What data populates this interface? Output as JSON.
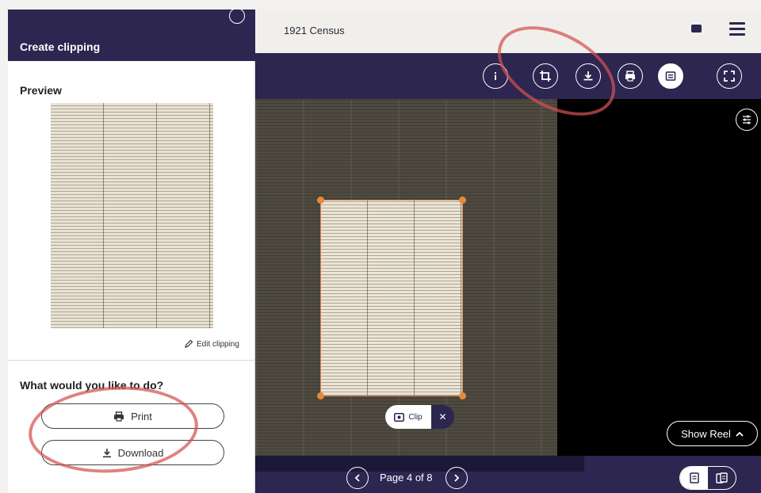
{
  "app": {
    "title": "1921 Census"
  },
  "toolbar": {
    "buttons": [
      {
        "name": "info",
        "icon": "info-icon"
      },
      {
        "name": "crop",
        "icon": "crop-icon"
      },
      {
        "name": "download",
        "icon": "download-icon"
      },
      {
        "name": "print",
        "icon": "print-icon"
      },
      {
        "name": "text",
        "icon": "text-view-icon"
      },
      {
        "name": "fullscreen",
        "icon": "fullscreen-icon"
      }
    ]
  },
  "panel": {
    "title": "Create clipping",
    "preview_label": "Preview",
    "edit_label": "Edit clipping",
    "question": "What would you like to do?",
    "print_label": "Print",
    "download_label": "Download"
  },
  "viewer": {
    "clip_label": "Clip",
    "close_glyph": "✕",
    "show_reel_label": "Show Reel",
    "page_label": "Page 4 of 8"
  },
  "colors": {
    "brand": "#2c2650",
    "accent": "#e8893a",
    "annotation": "#d45050"
  }
}
